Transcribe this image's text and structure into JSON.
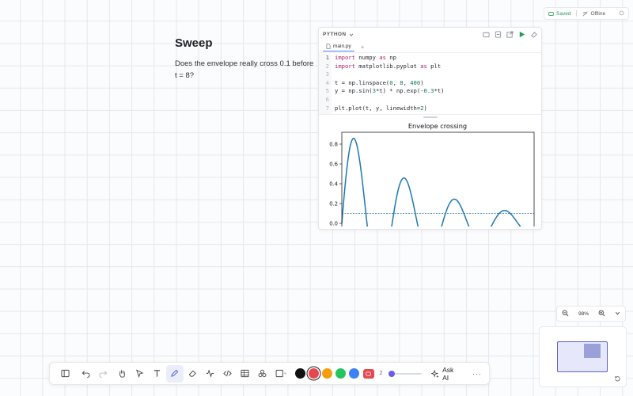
{
  "status": {
    "saved": "Saved",
    "offline": "Offline"
  },
  "note": {
    "title": "Sweep",
    "body": "Does the envelope really cross 0.1 before t = 8?"
  },
  "code_cell": {
    "language": "PYTHON",
    "tab": "main.py",
    "tab_add": "+",
    "line_numbers": [
      "1",
      "2",
      "3",
      "4",
      "5",
      "6",
      "7"
    ]
  },
  "chart_data": {
    "type": "line",
    "title": "Envelope crossing",
    "xlabel": "",
    "ylabel": "",
    "y_ticks": [
      "0.0",
      "0.2",
      "0.4",
      "0.6",
      "0.8"
    ],
    "ylim": [
      -0.08,
      0.92
    ],
    "xlim": [
      0,
      8
    ],
    "series": [
      {
        "function": "sin(3*t) * exp(-0.3*t)",
        "color": "#1f77b4",
        "linewidth": 2
      }
    ],
    "reference_line": {
      "y": 0.1,
      "style": "dashed",
      "color": "#1f77b4"
    },
    "grid": false
  },
  "toolbar": {
    "stroke_width": "2",
    "ask_ai": "Ask AI",
    "more": "···",
    "colors": [
      "#111111",
      "#e5484d",
      "#f59e0b",
      "#22c55e",
      "#3b82f6"
    ],
    "selected_color": "#e5484d"
  },
  "zoom": {
    "level": "98%",
    "minus": "−",
    "plus": "+"
  }
}
